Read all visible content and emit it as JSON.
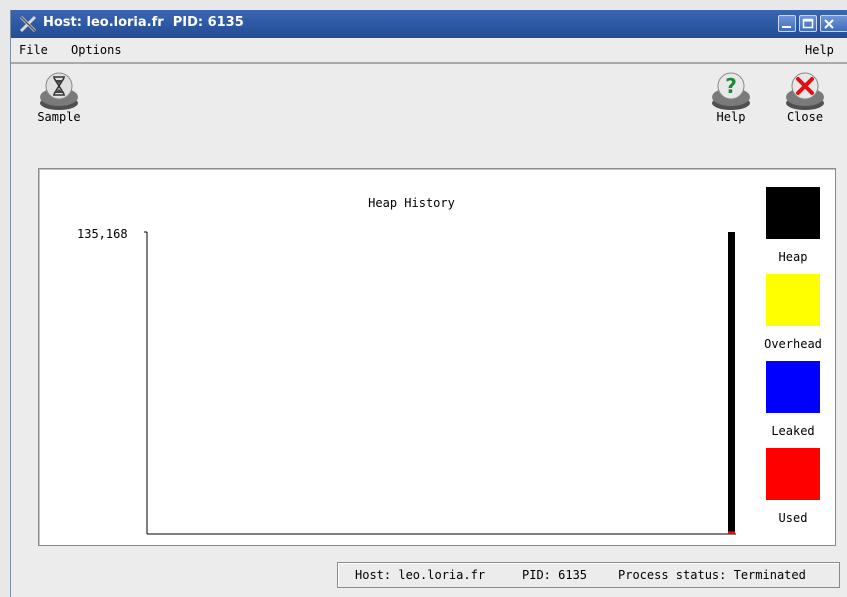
{
  "window": {
    "title": "Host: leo.loria.fr  PID: 6135"
  },
  "menu": {
    "file": "File",
    "options": "Options",
    "help": "Help"
  },
  "toolbar": {
    "sample": "Sample",
    "help": "Help",
    "close": "Close"
  },
  "chart_data": {
    "type": "bar",
    "title": "Heap History",
    "y_max_label": "135,168",
    "ylim": [
      0,
      135168
    ],
    "series": [
      {
        "name": "Heap",
        "color": "#000000",
        "values": [
          135168
        ]
      },
      {
        "name": "Overhead",
        "color": "#ffff00",
        "values": [
          0
        ]
      },
      {
        "name": "Leaked",
        "color": "#0000ff",
        "values": [
          0
        ]
      },
      {
        "name": "Used",
        "color": "#ff0000",
        "values": [
          1200
        ]
      }
    ],
    "legend_position": "right"
  },
  "status": {
    "host": "Host: leo.loria.fr",
    "pid": "PID: 6135",
    "process_status": "Process status: Terminated"
  }
}
